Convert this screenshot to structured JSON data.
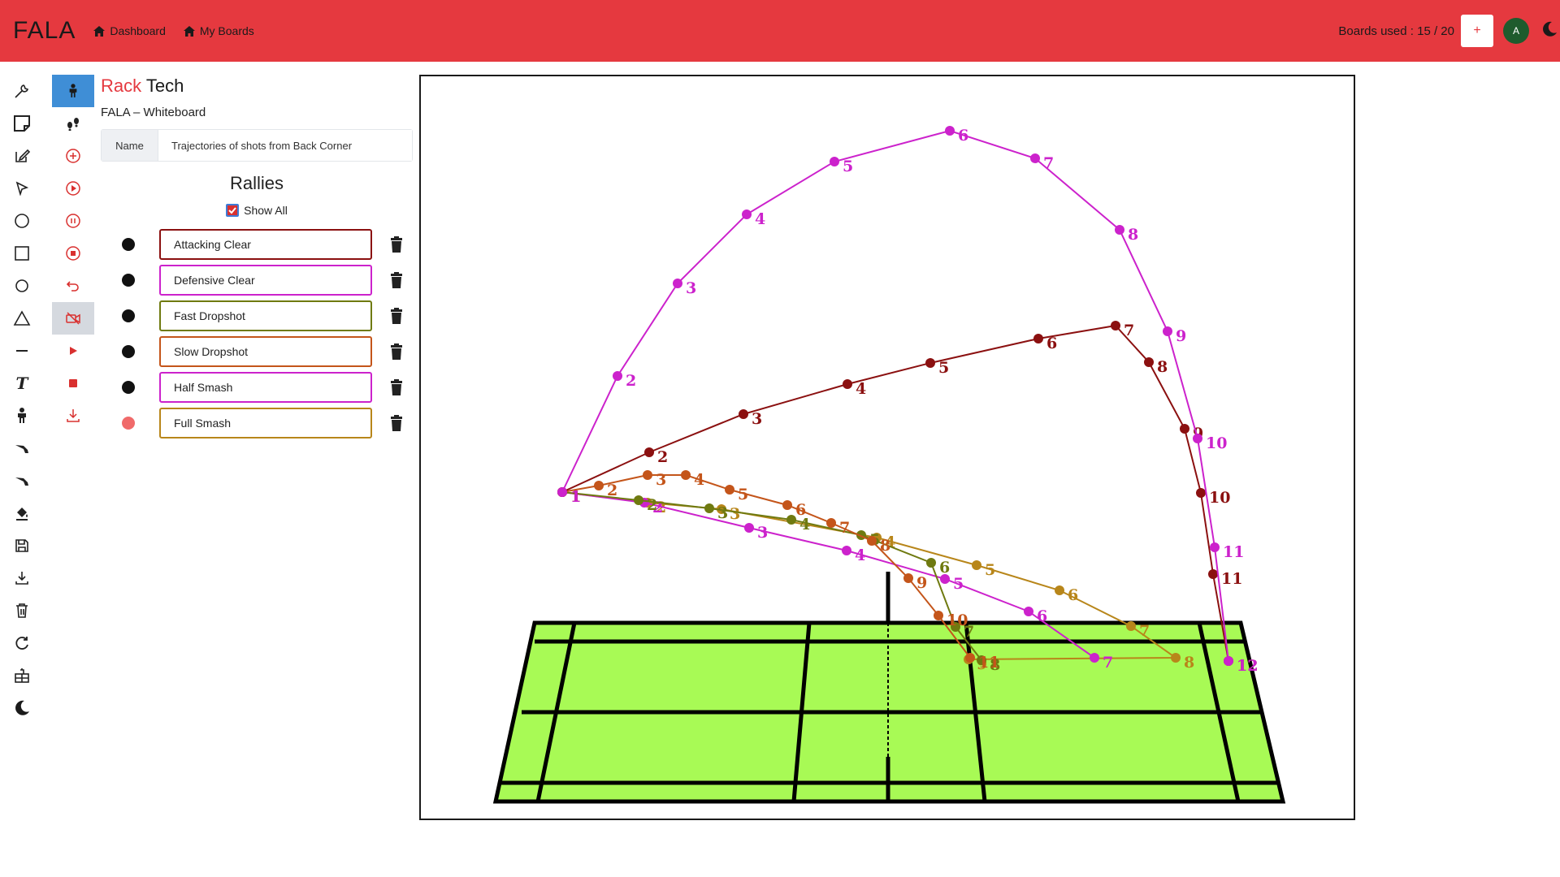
{
  "header": {
    "brand": "FALA",
    "nav": [
      {
        "label": "Dashboard",
        "icon": "home-icon"
      },
      {
        "label": "My Boards",
        "icon": "home-icon"
      }
    ],
    "boards_used": "Boards used : 15 / 20",
    "add_label": "+",
    "avatar_initial": "A",
    "theme_icon": "moon-icon"
  },
  "toolbar_main": [
    {
      "name": "wrench-icon"
    },
    {
      "name": "sticky-note-icon"
    },
    {
      "name": "edit-icon"
    },
    {
      "name": "pointer-icon"
    },
    {
      "name": "circle-icon"
    },
    {
      "name": "square-icon"
    },
    {
      "name": "circle-outline-icon"
    },
    {
      "name": "triangle-icon"
    },
    {
      "name": "line-icon"
    },
    {
      "name": "text-icon"
    },
    {
      "name": "player-icon"
    },
    {
      "name": "shuttlecock-icon"
    },
    {
      "name": "shuttlecock-alt-icon"
    },
    {
      "name": "paint-bucket-icon"
    },
    {
      "name": "save-icon"
    },
    {
      "name": "download-icon"
    },
    {
      "name": "trash-icon"
    },
    {
      "name": "refresh-icon"
    },
    {
      "name": "court-icon"
    },
    {
      "name": "moon-icon"
    }
  ],
  "toolbar_rally": [
    {
      "name": "player-icon"
    },
    {
      "name": "footsteps-icon"
    },
    {
      "name": "add-circle-icon"
    },
    {
      "name": "play-circle-icon"
    },
    {
      "name": "pause-circle-icon"
    },
    {
      "name": "stop-circle-icon"
    },
    {
      "name": "undo-icon"
    },
    {
      "name": "record-video-icon"
    },
    {
      "name": "play-icon"
    },
    {
      "name": "stop-icon"
    },
    {
      "name": "download-icon"
    }
  ],
  "panel": {
    "title_accent": "Rack",
    "title_rest": "Tech",
    "subtitle": "FALA – Whiteboard",
    "name_label": "Name",
    "name_value": "Trajectories of shots from Back Corner",
    "rallies_title": "Rallies",
    "show_all_label": "Show All",
    "show_all_checked": true
  },
  "rallies": [
    {
      "label": "Attacking Clear",
      "color": "#8b1010",
      "dot": "#111111"
    },
    {
      "label": "Defensive Clear",
      "color": "#cc22cc",
      "dot": "#111111"
    },
    {
      "label": "Fast Dropshot",
      "color": "#6f7a10",
      "dot": "#111111"
    },
    {
      "label": "Slow Dropshot",
      "color": "#c4551a",
      "dot": "#111111"
    },
    {
      "label": "Half Smash",
      "color": "#cc22cc",
      "dot": "#111111"
    },
    {
      "label": "Full Smash",
      "color": "#b8861a",
      "dot": "#f06a6a"
    }
  ],
  "court": {
    "fill": "#a8fa55",
    "line": "#000000"
  },
  "trajectory_labels": {
    "defensive": [
      "1",
      "2",
      "3",
      "4",
      "5",
      "6",
      "7",
      "8",
      "9",
      "10",
      "11",
      "12"
    ],
    "attacking": [
      "1",
      "2",
      "3",
      "4",
      "5",
      "6",
      "7",
      "8",
      "9",
      "10",
      "11",
      "12"
    ],
    "slow_drop": [
      "1",
      "2",
      "3",
      "4",
      "5",
      "6",
      "7",
      "8",
      "9",
      "10",
      "11"
    ],
    "fast_drop": [
      "1",
      "2",
      "3",
      "4",
      "5",
      "6",
      "7",
      "8"
    ],
    "half_smash": [
      "1",
      "2",
      "3",
      "4",
      "5",
      "6",
      "7"
    ],
    "full_smash": [
      "1",
      "2",
      "3",
      "4",
      "5",
      "6",
      "7",
      "8",
      "9"
    ]
  }
}
